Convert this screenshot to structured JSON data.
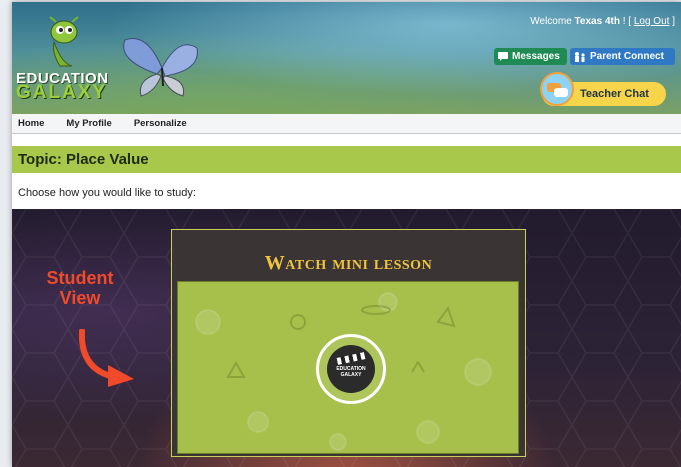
{
  "header": {
    "welcome_prefix": "Welcome ",
    "user_name": "Texas 4th",
    "welcome_sep": " ! [ ",
    "logout": "Log Out",
    "welcome_end": " ]",
    "messages_label": "Messages",
    "parent_connect_label": "Parent Connect",
    "teacher_chat_label": "Teacher Chat",
    "logo_line1": "EDUCATION",
    "logo_line2": "GALAXY"
  },
  "nav": {
    "items": [
      "Home",
      "My Profile",
      "Personalize"
    ]
  },
  "topic": {
    "title": "Topic: Place Value",
    "prompt": "Choose how you would like to study:"
  },
  "lesson": {
    "title": "Watch mini lesson",
    "icon_text_line1": "EDUCATION",
    "icon_text_line2": "GALAXY"
  },
  "annotation": {
    "line1": "Student",
    "line2": "View",
    "color": "#f04a2a"
  },
  "colors": {
    "topic_bar": "#a8c84c",
    "messages_button": "#1f8a54",
    "parent_connect_button": "#2f79c4",
    "teacher_chat": "#f7d54a",
    "lesson_title": "#f0c33c"
  }
}
